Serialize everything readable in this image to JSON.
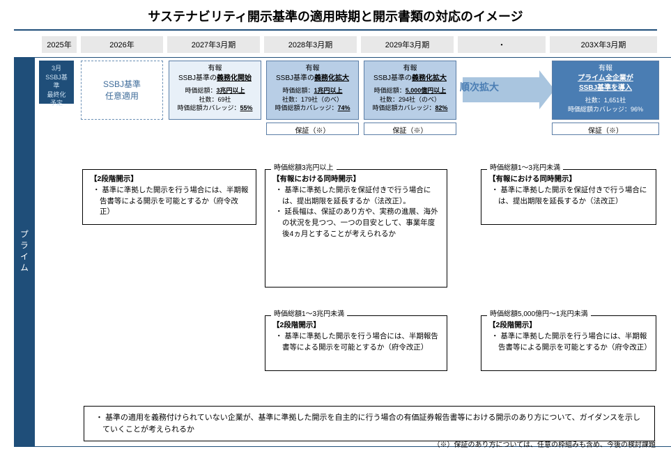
{
  "title": "サステナビリティ開示基準の適用時期と開示書類の対応のイメージ",
  "timeline": [
    "2025年",
    "2026年",
    "2027年3月期",
    "2028年3月期",
    "2029年3月期",
    "・",
    "203X年3月期"
  ],
  "sideLabel": "プライム",
  "box2025": {
    "month": "3月",
    "l1": "SSBJ基準",
    "l2": "最終化",
    "l3": "予定"
  },
  "box2026": "SSBJ基準\n任意適用",
  "phase2027": {
    "top": "有報",
    "sub": "SSBJ基準の義務化開始",
    "s1": "時価総額：3兆円以上",
    "s2": "社数：69社",
    "s3": "時価総額カバレッジ：55%"
  },
  "phase2028": {
    "top": "有報",
    "sub": "SSBJ基準の義務化拡大",
    "s1": "時価総額：1兆円以上",
    "s2": "社数：179社（のべ）",
    "s3": "時価総額カバレッジ：74%"
  },
  "phase2029": {
    "top": "有報",
    "sub": "SSBJ基準の義務化拡大",
    "s1": "時価総額：5,000億円以上",
    "s2": "社数：294社（のべ）",
    "s3": "時価総額カバレッジ：82%"
  },
  "phase203x": {
    "top": "有報",
    "sub1": "プライム全企業が",
    "sub2": "SSBJ基準を導入",
    "s2": "社数：1,651社",
    "s3": "時価総額カバレッジ：96%"
  },
  "assurance": "保証（※）",
  "expandLabel": "順次拡大",
  "g1": {
    "title": "【2段階開示】",
    "b1": "基準に準拠した開示を行う場合には、半期報告書等による開示を可能とするか（府令改正）"
  },
  "g2": {
    "hdr": "時価総額3兆円以上",
    "title": "【有報における同時開示】",
    "b1": "基準に準拠した開示を保証付きで行う場合には、提出期限を延長するか（法改正）。",
    "b2": "延長幅は、保証のあり方や、実務の進展、海外の状況を見つつ、一つの目安として、事業年度後4ヵ月とすることが考えられるか"
  },
  "g3": {
    "hdr": "時価総額1～3兆円未満",
    "title": "【有報における同時開示】",
    "b1": "基準に準拠した開示を保証付きで行う場合には、提出期限を延長するか（法改正）"
  },
  "g4": {
    "hdr": "時価総額1～3兆円未満",
    "title": "【2段階開示】",
    "b1": "基準に準拠した開示を行う場合には、半期報告書等による開示を可能とするか（府令改正）"
  },
  "g5": {
    "hdr": "時価総額5,000億円～1兆円未満",
    "title": "【2段階開示】",
    "b1": "基準に準拠した開示を行う場合には、半期報告書等による開示を可能とするか（府令改正）"
  },
  "guidance": "基準の適用を義務付けられていない企業が、基準に準拠した開示を自主的に行う場合の有価証券報告書等における開示のあり方について、ガイダンスを示していくことが考えられるか",
  "footnote": "（※）保証のあり方については、任意の枠組みも含め、今後の検討課題"
}
